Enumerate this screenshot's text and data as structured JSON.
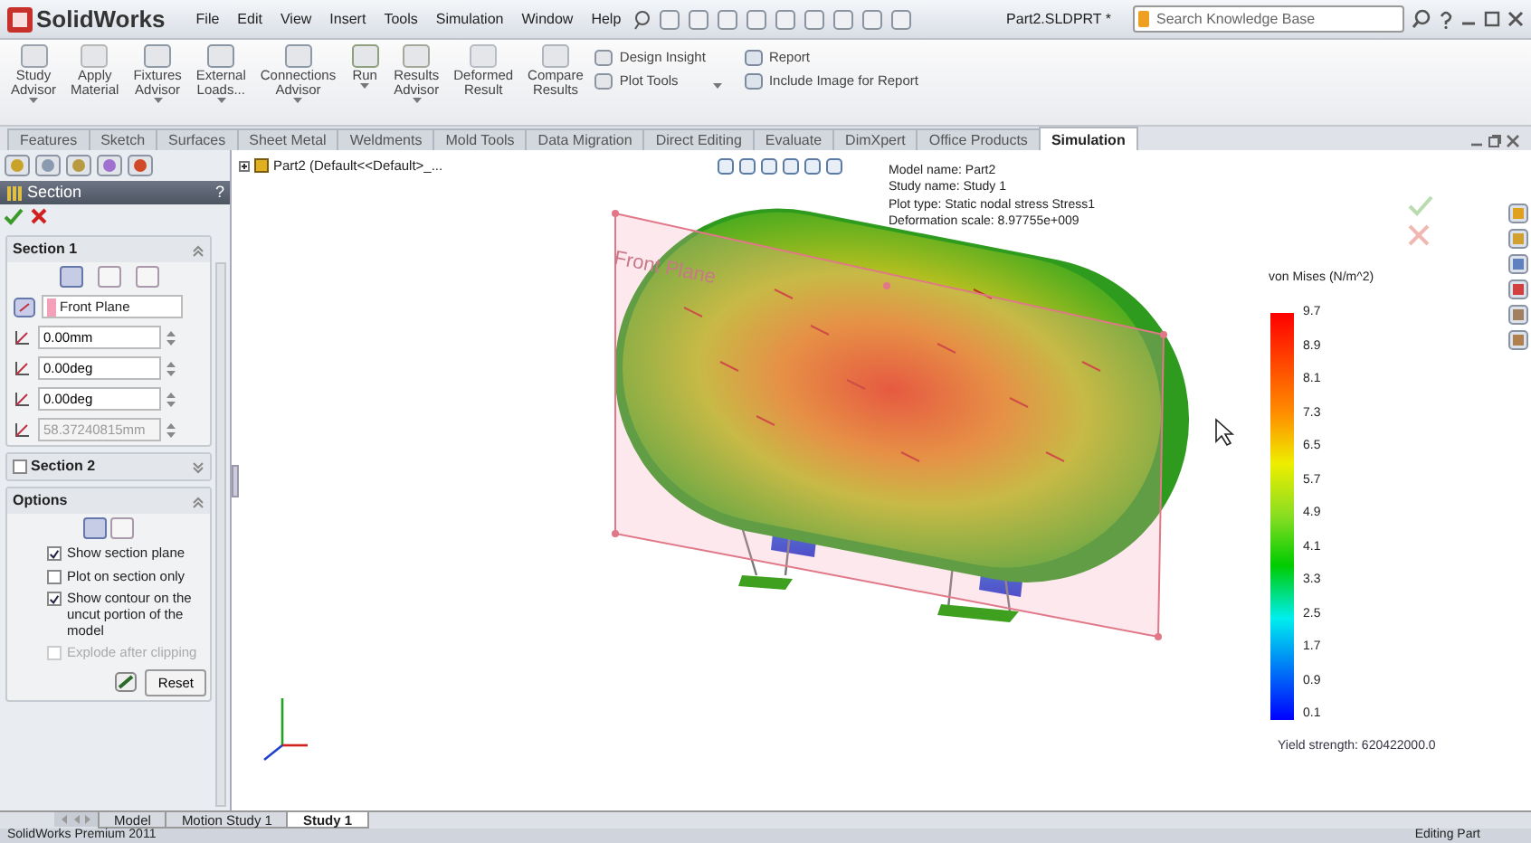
{
  "app": {
    "logo": "SolidWorks",
    "menu": [
      "File",
      "Edit",
      "View",
      "Insert",
      "Tools",
      "Simulation",
      "Window",
      "Help"
    ],
    "document_title": "Part2.SLDPRT *",
    "search": {
      "placeholder": "Search Knowledge Base"
    }
  },
  "ribbon": {
    "tools": [
      {
        "label": "Study\nAdvisor",
        "menu": true
      },
      {
        "label": "Apply\nMaterial",
        "menu": false
      },
      {
        "label": "Fixtures\nAdvisor",
        "menu": true
      },
      {
        "label": "External\nLoads...",
        "menu": true
      },
      {
        "label": "Connections\nAdvisor",
        "menu": true
      },
      {
        "label": "Run",
        "menu": true
      },
      {
        "label": "Results\nAdvisor",
        "menu": true
      },
      {
        "label": "Deformed\nResult",
        "menu": false
      },
      {
        "label": "Compare\nResults",
        "menu": false
      }
    ],
    "small_tools": [
      {
        "label": "Design Insight"
      },
      {
        "label": "Plot Tools"
      }
    ],
    "report_tools": [
      {
        "label": "Report"
      },
      {
        "label": "Include Image for Report"
      }
    ]
  },
  "tabs": [
    {
      "label": "Features",
      "selected": false
    },
    {
      "label": "Sketch",
      "selected": false
    },
    {
      "label": "Surfaces",
      "selected": false
    },
    {
      "label": "Sheet Metal",
      "selected": false
    },
    {
      "label": "Weldments",
      "selected": false
    },
    {
      "label": "Mold Tools",
      "selected": false
    },
    {
      "label": "Data Migration",
      "selected": false
    },
    {
      "label": "Direct Editing",
      "selected": false
    },
    {
      "label": "Evaluate",
      "selected": false
    },
    {
      "label": "DimXpert",
      "selected": false
    },
    {
      "label": "Office Products",
      "selected": false
    },
    {
      "label": "Simulation",
      "selected": true
    }
  ],
  "property_manager": {
    "title": "Section",
    "help": "?",
    "section_1": {
      "title": "Section 1",
      "expanded": true,
      "type_buttons": [
        {
          "selected": true
        },
        {
          "selected": false
        },
        {
          "selected": false
        }
      ],
      "reference": "Front Plane",
      "fields": [
        {
          "value": "0.00mm",
          "disabled": false
        },
        {
          "value": "0.00deg",
          "disabled": false
        },
        {
          "value": "0.00deg",
          "disabled": false
        },
        {
          "value": "58.37240815mm",
          "disabled": true
        }
      ]
    },
    "section_2": {
      "title": "Section 2",
      "checked": false,
      "expanded": false
    },
    "options": {
      "title": "Options",
      "expanded": true,
      "mode_buttons": [
        {
          "selected": true
        },
        {
          "selected": false
        }
      ],
      "checkboxes": [
        {
          "label": "Show section plane",
          "checked": true,
          "disabled": false
        },
        {
          "label": "Plot on section only",
          "checked": false,
          "disabled": false
        },
        {
          "label": "Show contour on the uncut portion of the model",
          "checked": true,
          "disabled": false
        },
        {
          "label": "Explode after clipping",
          "checked": false,
          "disabled": true
        }
      ],
      "reset": "Reset"
    }
  },
  "viewport": {
    "tree_item": "Part2  (Default<<Default>_...",
    "plot_info": [
      "Model name: Part2",
      "Study name: Study 1",
      "Plot type: Static nodal stress Stress1",
      "Deformation scale: 8.97755e+009"
    ],
    "plane_label": "Front Plane",
    "legend": {
      "title": "von Mises (N/m^2)",
      "labels": [
        "9.7",
        "8.9",
        "8.1",
        "7.3",
        "6.5",
        "5.7",
        "4.9",
        "4.1",
        "3.3",
        "2.5",
        "1.7",
        "0.9",
        "0.1"
      ],
      "yield": "Yield strength: 620422000.0"
    }
  },
  "bottom_tabs": [
    {
      "label": "Model",
      "selected": false
    },
    {
      "label": "Motion Study 1",
      "selected": false
    },
    {
      "label": "Study 1",
      "selected": true
    }
  ],
  "status": {
    "product": "SolidWorks Premium 2011",
    "mode": "Editing Part"
  }
}
